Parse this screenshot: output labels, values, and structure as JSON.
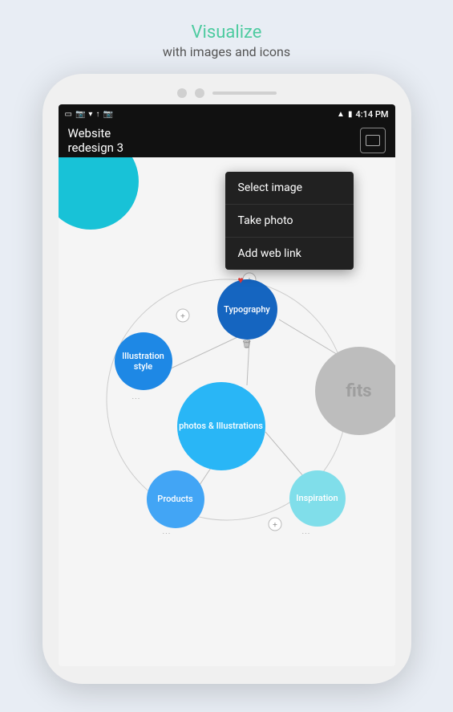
{
  "header": {
    "title": "Visualize",
    "subtitle": "with images and icons"
  },
  "status_bar": {
    "time": "4:14 PM",
    "icons_left": [
      "battery-icon",
      "phone-icon",
      "notification-icon",
      "upload-icon",
      "camera-icon"
    ],
    "icons_right": [
      "wifi-icon",
      "battery-full-icon"
    ]
  },
  "app_bar": {
    "title": "Website\nredesign 3"
  },
  "dropdown": {
    "items": [
      {
        "label": "Select image"
      },
      {
        "label": "Take photo"
      },
      {
        "label": "Add web link"
      }
    ]
  },
  "nodes": [
    {
      "id": "typography",
      "label": "Typography"
    },
    {
      "id": "illustration",
      "label": "Illustration style"
    },
    {
      "id": "photos",
      "label": "photos &\nIllustrations"
    },
    {
      "id": "inspiration",
      "label": "Inspiration"
    },
    {
      "id": "products",
      "label": "Products"
    }
  ],
  "fits_label": "fits"
}
